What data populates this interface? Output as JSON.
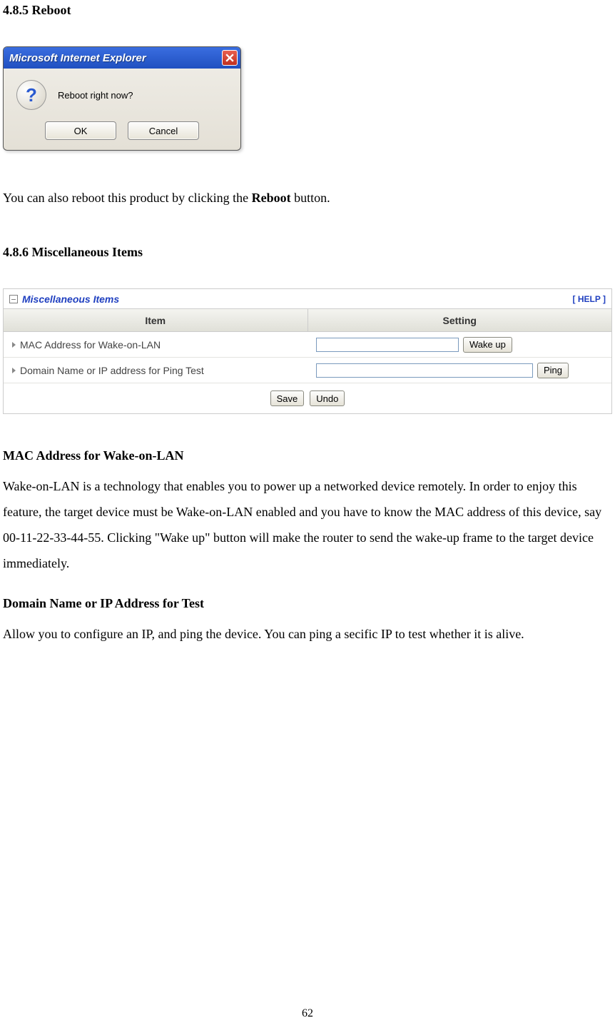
{
  "headings": {
    "reboot": "4.8.5 Reboot",
    "misc": "4.8.6 Miscellaneous Items"
  },
  "dialog": {
    "title": "Microsoft Internet Explorer",
    "message": "Reboot right now?",
    "ok": "OK",
    "cancel": "Cancel"
  },
  "para_reboot_pre": "You can also reboot this product by clicking the ",
  "para_reboot_bold": "Reboot",
  "para_reboot_post": " button.",
  "misc_panel": {
    "title": "Miscellaneous Items",
    "help": "[ HELP ]",
    "col_item": "Item",
    "col_setting": "Setting",
    "row_mac": "MAC Address for Wake-on-LAN",
    "row_ping": "Domain Name or IP address for Ping Test",
    "btn_wake": "Wake up",
    "btn_ping": "Ping",
    "btn_save": "Save",
    "btn_undo": "Undo",
    "mac_value": "",
    "ping_value": ""
  },
  "mac_heading": "MAC Address for Wake-on-LAN",
  "mac_para": "Wake-on-LAN is a technology that enables you to power up a networked device remotely. In order to enjoy this feature, the target device must be Wake-on-LAN enabled and you have to know the MAC address of this device, say 00-11-22-33-44-55. Clicking \"Wake up\" button will make the router to send the wake-up frame to the target device immediately.",
  "domain_heading": "Domain Name or IP Address for Test",
  "domain_para": "Allow you to configure an IP, and ping the device. You can ping a secific IP to test whether it is alive.",
  "page_number": "62"
}
